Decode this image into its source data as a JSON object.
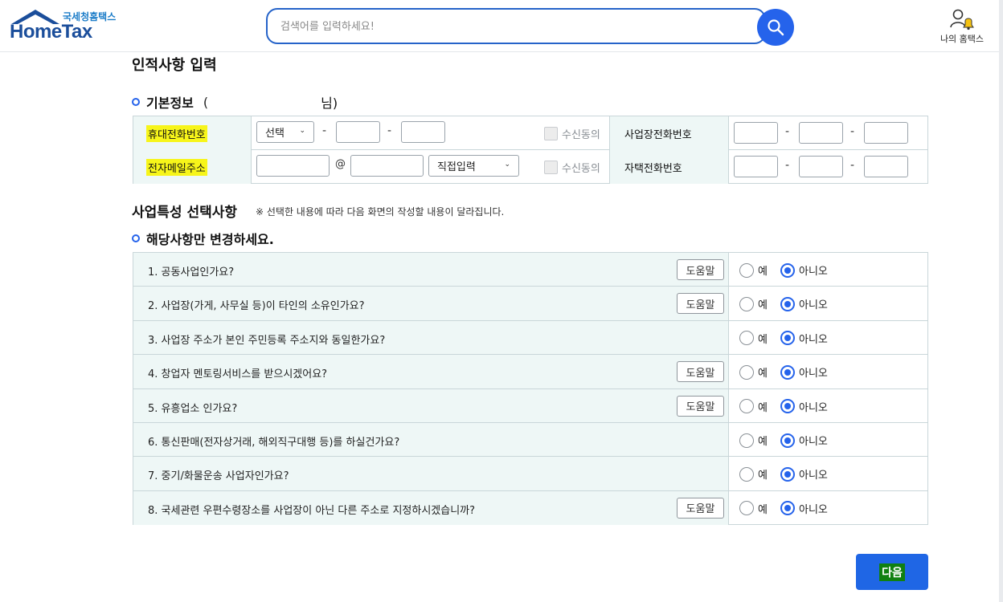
{
  "header": {
    "logo_kr": "국세청홈택스",
    "logo_en": "HomeTax",
    "search_placeholder": "검색어를 입력하세요!",
    "my_hometax": "나의 홈택스"
  },
  "page": {
    "title": "인적사항 입력"
  },
  "basic_info": {
    "heading": "기본정보",
    "paren_open": "(",
    "name_suffix": "님)",
    "mobile_label": "휴대전화번호",
    "mobile_select": "선택",
    "email_label": "전자메일주소",
    "email_at": "@",
    "email_select": "직접입력",
    "agree_label": "수신동의",
    "biz_phone_label": "사업장전화번호",
    "home_phone_label": "자택전화번호",
    "dash": "-"
  },
  "business": {
    "title": "사업특성 선택사항",
    "note": "※ 선택한 내용에 따라 다음 화면의 작성할 내용이 달라집니다.",
    "heading": "해당사항만 변경하세요.",
    "help_label": "도움말",
    "yes_label": "예",
    "no_label": "아니오",
    "questions": [
      {
        "text": "1. 공동사업인가요?",
        "help": true,
        "answer": "no"
      },
      {
        "text": "2. 사업장(가게, 사무실 등)이 타인의 소유인가요?",
        "help": true,
        "answer": "no"
      },
      {
        "text": "3. 사업장 주소가 본인 주민등록 주소지와 동일한가요?",
        "help": false,
        "answer": "no"
      },
      {
        "text": "4. 창업자 멘토링서비스를 받으시겠어요?",
        "help": true,
        "answer": "no"
      },
      {
        "text": "5. 유흥업소 인가요?",
        "help": true,
        "answer": "no"
      },
      {
        "text": "6. 통신판매(전자상거래, 해외직구대행 등)를 하실건가요?",
        "help": false,
        "answer": "no"
      },
      {
        "text": "7. 중기/화물운송 사업자인가요?",
        "help": false,
        "answer": "no"
      },
      {
        "text": "8. 국세관련 우편수령장소를 사업장이 아닌 다른 주소로 지정하시겠습니까?",
        "help": true,
        "answer": "no"
      }
    ]
  },
  "footer": {
    "next_label": "다음"
  },
  "colors": {
    "primary": "#2563eb",
    "label_bg": "#eef7f6",
    "highlight": "#f7f51a"
  }
}
